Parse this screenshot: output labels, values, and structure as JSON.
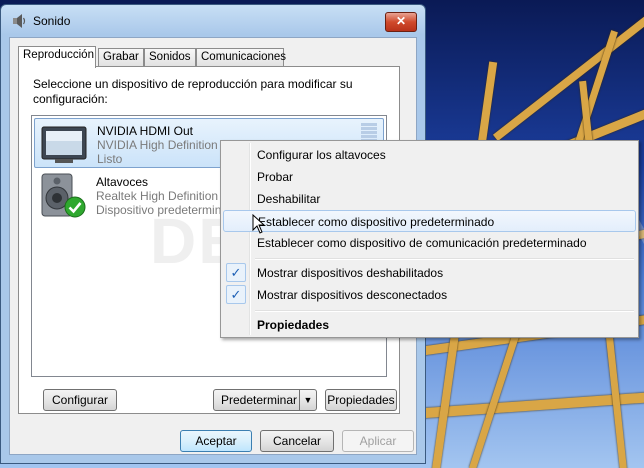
{
  "window": {
    "title": "Sonido",
    "close_label": "✕"
  },
  "tabs": [
    {
      "label": "Reproducción",
      "active": true
    },
    {
      "label": "Grabar",
      "active": false
    },
    {
      "label": "Sonidos",
      "active": false
    },
    {
      "label": "Comunicaciones",
      "active": false
    }
  ],
  "instructions": "Seleccione un dispositivo de reproducción para modificar su configuración:",
  "devices": [
    {
      "name": "NVIDIA HDMI Out",
      "driver": "NVIDIA High Definition Audio",
      "status": "Listo",
      "icon": "monitor-icon",
      "selected": true
    },
    {
      "name": "Altavoces",
      "driver": "Realtek High Definition",
      "status": "Dispositivo predetermin",
      "icon": "speaker-icon",
      "default": true
    }
  ],
  "panel_buttons": {
    "configure": "Configurar",
    "set_default": "Predeterminar",
    "properties": "Propiedades"
  },
  "dialog_buttons": {
    "ok": "Aceptar",
    "cancel": "Cancelar",
    "apply": "Aplicar"
  },
  "context_menu": {
    "items": [
      {
        "label": "Configurar los altavoces"
      },
      {
        "label": "Probar"
      },
      {
        "label": "Deshabilitar"
      },
      {
        "label": "Establecer como dispositivo predeterminado",
        "hover": true
      },
      {
        "label": "Establecer como dispositivo de comunicación predeterminado"
      },
      {
        "label": "Mostrar dispositivos deshabilitados",
        "checked": true
      },
      {
        "label": "Mostrar dispositivos desconectados",
        "checked": true
      },
      {
        "label": "Propiedades",
        "bold": true
      }
    ]
  },
  "watermark": "DEMO VERSION",
  "colors": {
    "accent": "#1c5fb5",
    "selection": "#cbe3f9",
    "default_check": "#2fa82f"
  }
}
